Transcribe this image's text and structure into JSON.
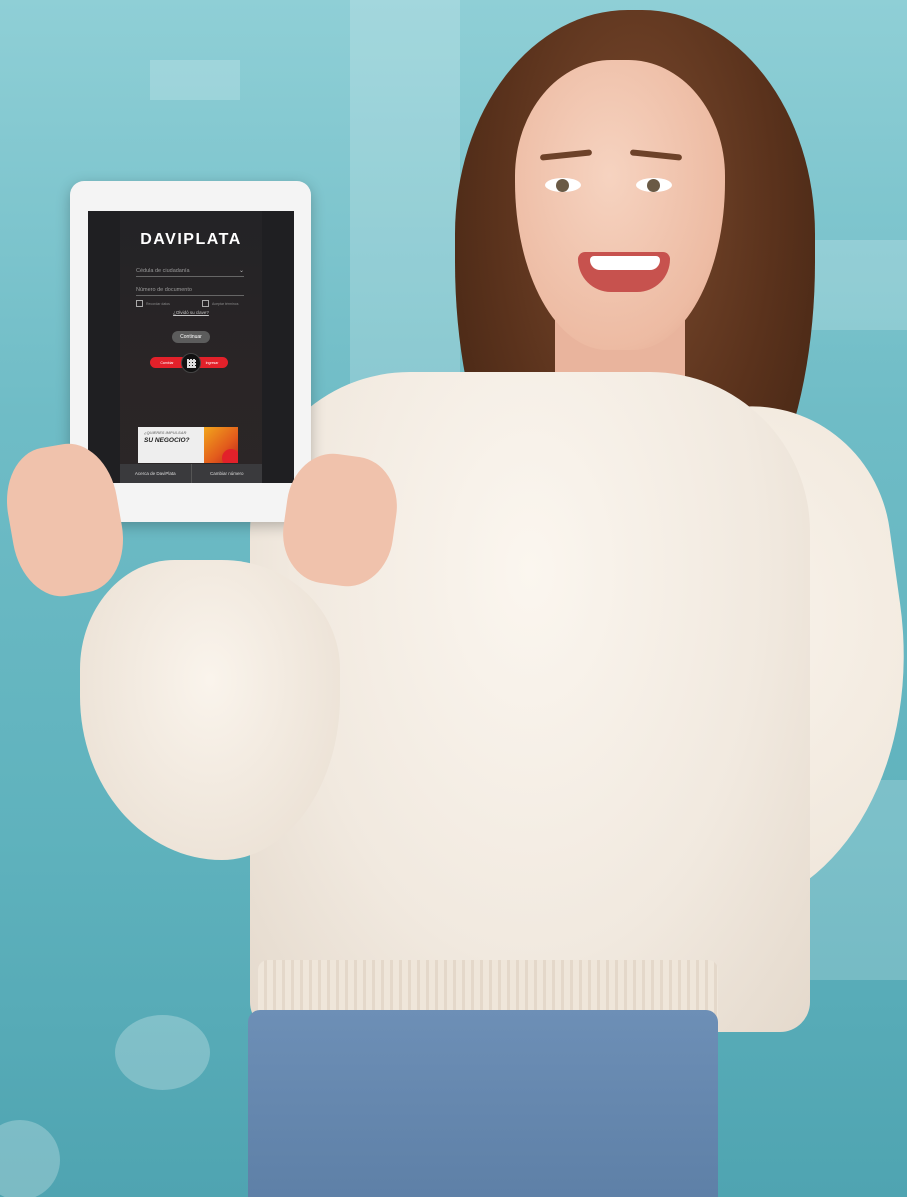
{
  "tablet": {
    "logo": "DAVIPLATA",
    "doc_type_placeholder": "Cédula de ciudadanía",
    "doc_number_placeholder": "Número de documento",
    "remember_label": "Recordar datos",
    "accept_label": "Aceptar términos",
    "forgot_link": "¿Olvidó su clave?",
    "continue_button": "Continuar",
    "left_red_button": "Cambiar",
    "right_red_button": "Ingresar",
    "banner": {
      "line1": "¿QUIERES IMPULSAR",
      "line2": "SU NEGOCIO?"
    },
    "bottom_tabs": [
      "Acerca de DaviPlata",
      "Cambiar número"
    ]
  },
  "colors": {
    "background_teal": "#6fbcc6",
    "brand_red": "#e2212a",
    "screen_dark": "#1f1f22"
  }
}
